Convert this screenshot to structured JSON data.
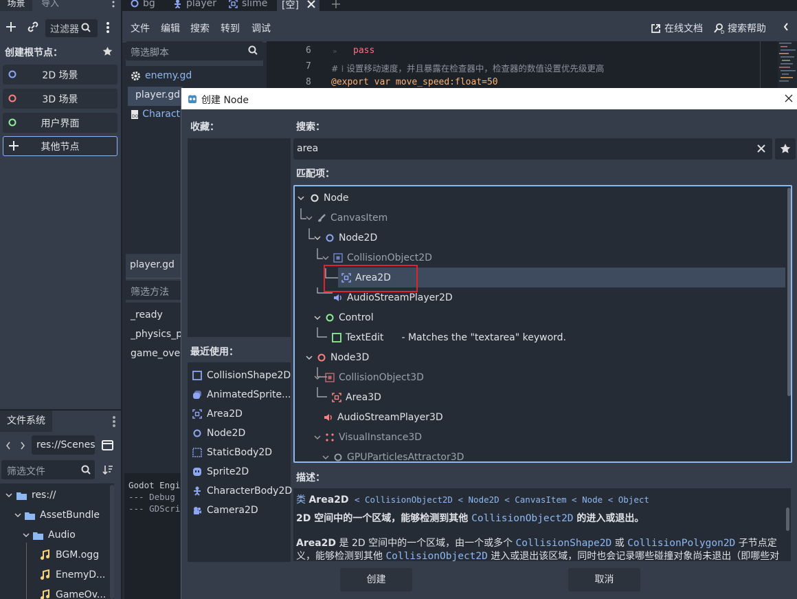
{
  "scene_dock": {
    "tabs": [
      "场景",
      "导入"
    ],
    "filter_placeholder": "过滤器",
    "create_root_label": "创建根节点：",
    "root_buttons": [
      "2D 场景",
      "3D 场景",
      "用户界面",
      "其他节点"
    ]
  },
  "filesystem": {
    "tab": "文件系统",
    "path": "res://Scenes",
    "filter_placeholder": "筛选文件",
    "tree": [
      "res://",
      "AssetBundle",
      "Audio",
      "BGM.ogg",
      "EnemyD...",
      "GameOv..."
    ]
  },
  "editor_tabs": [
    "bg",
    "player",
    "slime",
    "[空]"
  ],
  "script_menu": [
    "文件",
    "编辑",
    "搜索",
    "转到",
    "调试"
  ],
  "script_links": {
    "docs": "在线文档",
    "help": "搜索帮助"
  },
  "script_list": {
    "filter_placeholder": "筛选脚本",
    "items": [
      "enemy.gd",
      "player.gd",
      "Charact"
    ],
    "current": "player.gd",
    "methods_filter_placeholder": "筛选方法",
    "methods": [
      "_ready",
      "_physics_pr",
      "game_over"
    ]
  },
  "code": {
    "lines": [
      {
        "no": "6",
        "text": "pass"
      },
      {
        "no": "7",
        "text": "# ⁞ 设置移动速度，并且暴露在检查器中，检查器的数值设置优先级更高"
      },
      {
        "no": "8",
        "text": "@export var move_speed:float=50"
      }
    ]
  },
  "output": {
    "lines": [
      "Godot Engi",
      "--- Debug",
      "--- GDScri"
    ]
  },
  "dialog": {
    "title": "创建 Node",
    "favorites_label": "收藏：",
    "recent_label": "最近使用：",
    "search_label": "搜索：",
    "search_value": "area",
    "matches_label": "匹配项：",
    "tree": [
      {
        "name": "Node",
        "dim": false
      },
      {
        "name": "CanvasItem",
        "dim": true
      },
      {
        "name": "Node2D",
        "dim": false
      },
      {
        "name": "CollisionObject2D",
        "dim": true
      },
      {
        "name": "Area2D",
        "dim": false,
        "selected": true
      },
      {
        "name": "AudioStreamPlayer2D",
        "dim": false
      },
      {
        "name": "Control",
        "dim": false
      },
      {
        "name": "TextEdit",
        "dim": false,
        "note": "- Matches the \"textarea\" keyword."
      },
      {
        "name": "Node3D",
        "dim": false
      },
      {
        "name": "CollisionObject3D",
        "dim": true
      },
      {
        "name": "Area3D",
        "dim": false
      },
      {
        "name": "AudioStreamPlayer3D",
        "dim": false
      },
      {
        "name": "VisualInstance3D",
        "dim": true
      },
      {
        "name": "GPUParticlesAttractor3D",
        "dim": true
      }
    ],
    "recent": [
      "CollisionShape2D",
      "AnimatedSprite...",
      "Area2D",
      "Node2D",
      "StaticBody2D",
      "Sprite2D",
      "CharacterBody2D",
      "Camera2D"
    ],
    "description_label": "描述：",
    "desc_class_kw": "类",
    "desc_class": "Area2D",
    "desc_inherits": "< CollisionObject2D < Node2D < CanvasItem < Node < Object",
    "desc_brief_a": "2D 空间中的一个区域，能够检测到其他",
    "desc_brief_code": "CollisionObject2D",
    "desc_brief_b": "的进入或退出。",
    "desc_p_bold": "Area2D",
    "desc_p_a": "是 2D 空间中的一个区域，由一个或多个",
    "desc_p_code1": "CollisionShape2D",
    "desc_p_or": "或",
    "desc_p_code2": "CollisionPolygon2D",
    "desc_p_b": "子节点定",
    "desc_p2_a": "义，能够检测到其他",
    "desc_p2_code": "CollisionObject2D",
    "desc_p2_b": "进入或退出该区域，同时也会记录哪些碰撞对象尚未退出（即哪些对",
    "create_button": "创建",
    "cancel_button": "取消"
  },
  "colors": {
    "accent": "#8eb8f0",
    "selected_row": "#3e4b5e",
    "highlight_box": "#e0252a"
  }
}
